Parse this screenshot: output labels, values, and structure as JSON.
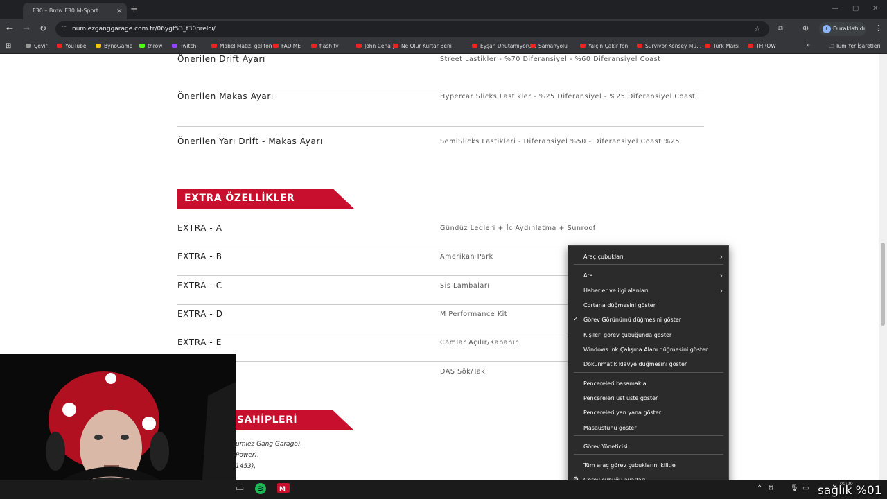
{
  "browser": {
    "tab_title": "Bmw F30 M-Sport",
    "tab_title_prefix": "F30",
    "close": "×",
    "new_tab": "+",
    "url": "numiezganggarage.com.tr/06ygt53_f30prelci/",
    "profile_initial": "t",
    "profile_label": "Duraklatıldı",
    "bookmarks": [
      {
        "label": "Çevir",
        "kind": "s"
      },
      {
        "label": "YouTube",
        "kind": "y"
      },
      {
        "label": "BynoGame",
        "kind": "g"
      },
      {
        "label": "throw",
        "kind": "k"
      },
      {
        "label": "Twitch",
        "kind": "t"
      },
      {
        "label": "Mabel Matiz. gel fon",
        "kind": "y"
      },
      {
        "label": "FADIME",
        "kind": "y"
      },
      {
        "label": "flash tv",
        "kind": "y"
      },
      {
        "label": "John Cena )",
        "kind": "y"
      },
      {
        "label": "Ne Olur Kurtar Beni",
        "kind": "y"
      },
      {
        "label": "Eyşan Unutamıyoru...",
        "kind": "y"
      },
      {
        "label": "Samanyolu",
        "kind": "y"
      },
      {
        "label": "Yalçın Çakır fon",
        "kind": "y"
      },
      {
        "label": "Survivor Konsey Mü...",
        "kind": "y"
      },
      {
        "label": "Türk Marşı",
        "kind": "y"
      },
      {
        "label": "THROW",
        "kind": "y"
      }
    ],
    "all_bookmarks": "Tüm Yer İşaretleri"
  },
  "page": {
    "tuning_rows": [
      {
        "label": "Önerilen Drift Ayarı",
        "value": "Street Lastikler - %70 Diferansiyel - %60 Diferansiyel Coast"
      },
      {
        "label": "Önerilen Makas Ayarı",
        "value": "Hypercar Slicks Lastikler - %25 Diferansiyel - %25 Diferansiyel Coast"
      },
      {
        "label": "Önerilen Yarı Drift - Makas Ayarı",
        "value": "SemiSlicks Lastikleri - Diferansiyel %50 - Diferansiyel Coast %25"
      }
    ],
    "extras_heading": "EXTRA ÖZELLİKLER",
    "extras": [
      {
        "label": "EXTRA - A",
        "value": "Gündüz Ledleri + İç Aydınlatma + Sunroof"
      },
      {
        "label": "EXTRA - B",
        "value": "Amerikan Park"
      },
      {
        "label": "EXTRA - C",
        "value": "Sis Lambaları"
      },
      {
        "label": "EXTRA - D",
        "value": "M Performance Kit"
      },
      {
        "label": "EXTRA - E",
        "value": "Camlar Açılır/Kapanır"
      },
      {
        "label": "",
        "value": "DAS Sök/Tak"
      }
    ],
    "owners_heading": "SAHİPLERİ",
    "owner_lines": [
      "umiez Gang Garage),",
      "Power),",
      "1453),"
    ]
  },
  "context_menu": {
    "items": [
      {
        "label": "Araç çubukları",
        "submenu": true
      },
      {
        "label": "Ara",
        "submenu": true
      },
      {
        "label": "Haberler ve ilgi alanları",
        "submenu": true
      },
      {
        "label": "Cortana düğmesini göster"
      },
      {
        "label": "Görev Görünümü düğmesini göster",
        "checked": true
      },
      {
        "label": "Kişileri görev çubuğunda göster"
      },
      {
        "label": "Windows Ink Çalışma Alanı düğmesini göster"
      },
      {
        "label": "Dokunmatik klavye düğmesini göster"
      },
      {
        "label": "Pencereleri basamakla"
      },
      {
        "label": "Pencereleri üst üste göster"
      },
      {
        "label": "Pencereleri yan yana göster"
      },
      {
        "label": "Masaüstünü göster"
      },
      {
        "label": "Görev Yöneticisi"
      },
      {
        "label": "Tüm araç görev çubuklarını kilitle"
      },
      {
        "label": "Görev çubuğu ayarları",
        "gear": true
      }
    ]
  },
  "overlay": {
    "text": "sağlık %01",
    "clock": "00:20"
  },
  "colors": {
    "banner_red": "#c8102e",
    "menu_bg": "#2b2b2b",
    "spotify_green": "#1db954"
  }
}
